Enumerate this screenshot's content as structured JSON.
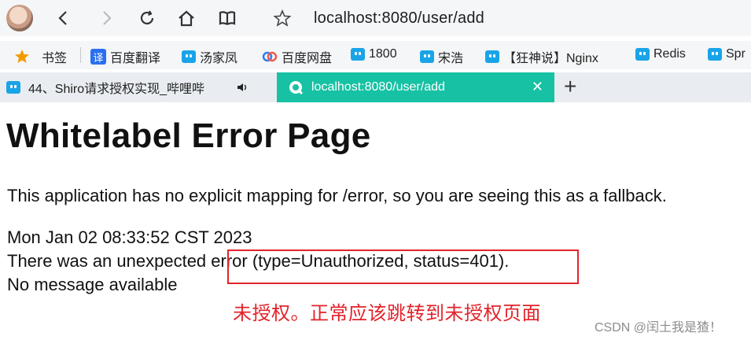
{
  "browser": {
    "url": "localhost:8080/user/add"
  },
  "bookmarks": [
    {
      "label": "书签",
      "icon": "star-icon"
    },
    {
      "label": "百度翻译",
      "icon": "translate-icon"
    },
    {
      "label": "汤家凤",
      "icon": "bilibili-icon"
    },
    {
      "label": "百度网盘",
      "icon": "baidu-pan-icon"
    },
    {
      "label": "1800",
      "icon": "bilibili-icon"
    },
    {
      "label": "宋浩",
      "icon": "bilibili-icon"
    },
    {
      "label": "【狂神说】Nginx",
      "icon": "bilibili-icon"
    },
    {
      "label": "Redis",
      "icon": "bilibili-icon"
    },
    {
      "label": "Spr",
      "icon": "bilibili-icon"
    }
  ],
  "tabs": [
    {
      "label": "44、Shiro请求授权实现_哔哩哔",
      "active": false
    },
    {
      "label": "localhost:8080/user/add",
      "active": true
    }
  ],
  "page": {
    "title": "Whitelabel Error Page",
    "fallback_text": "This application has no explicit mapping for /error, so you are seeing this as a fallback.",
    "timestamp": "Mon Jan 02 08:33:52 CST 2023",
    "error_prefix": "There was an unexpected ",
    "error_detail": "error (type=Unauthorized, status=401).",
    "message": "No message available"
  },
  "annotation": {
    "note": "未授权。正常应该跳转到未授权页面",
    "color": "#e2232a"
  },
  "watermark": "CSDN @闰土我是猹！",
  "colors": {
    "tab_active": "#17c1a4",
    "bookmark_icon": "#1aa4e8"
  }
}
